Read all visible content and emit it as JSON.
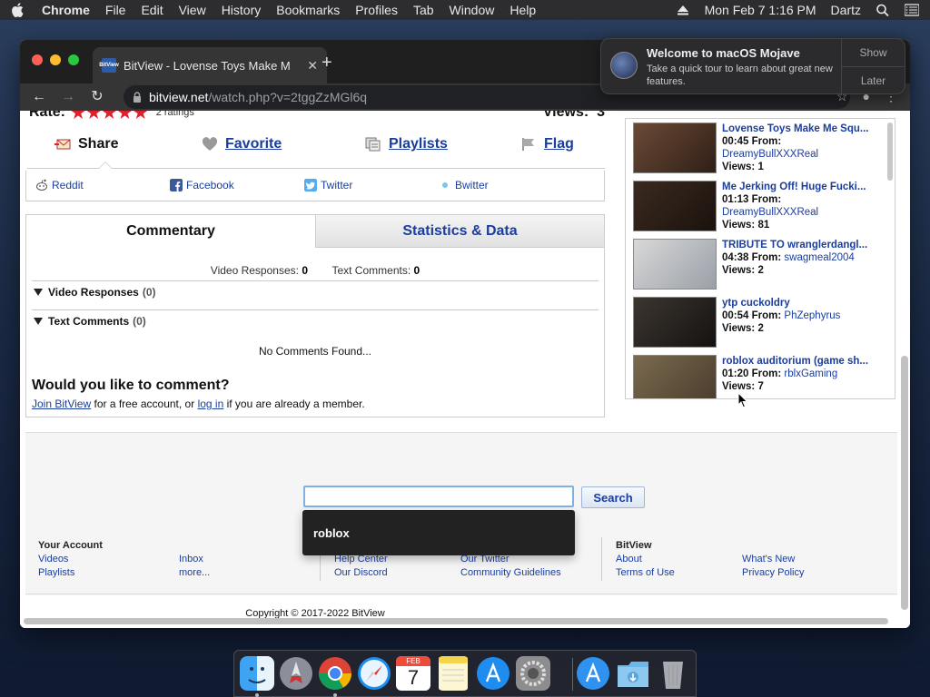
{
  "menubar": {
    "app": "Chrome",
    "items": [
      "File",
      "Edit",
      "View",
      "History",
      "Bookmarks",
      "Profiles",
      "Tab",
      "Window",
      "Help"
    ],
    "clock": "Mon Feb 7  1:16 PM",
    "user": "Dartz"
  },
  "browser": {
    "tab_title": "BitView - Lovense Toys Make M",
    "favicon_text": "BitView",
    "url_host": "bitview.net",
    "url_path": "/watch.php?v=2tggZzMGl6q"
  },
  "video": {
    "rate_label": "Rate:",
    "stars": "★★★★★",
    "ratings": "2 ratings",
    "views_label": "Views:",
    "views_value": "3"
  },
  "actions": {
    "share": "Share",
    "favorite": "Favorite",
    "playlists": "Playlists",
    "flag": "Flag"
  },
  "social": {
    "reddit": "Reddit",
    "facebook": "Facebook",
    "twitter": "Twitter",
    "bwitter": "Bwitter"
  },
  "comments_panel": {
    "tab_active": "Commentary",
    "tab_inactive": "Statistics & Data",
    "video_responses_label": "Video Responses:",
    "video_responses_value": "0",
    "text_comments_label": "Text Comments:",
    "text_comments_value": "0",
    "section_video_responses": "Video Responses",
    "section_video_responses_count": "(0)",
    "section_text_comments": "Text Comments",
    "section_text_comments_count": "(0)",
    "no_comments": "No Comments Found...",
    "comment_prompt": "Would you like to comment?",
    "join_link": "Join BitView",
    "join_text": " for a free account, or ",
    "login_link": "log in",
    "login_text": " if you are already a member."
  },
  "related": [
    {
      "title": "Lovense Toys Make Me Squ...",
      "duration": "00:45",
      "from_label": "From:",
      "user": "DreamyBullXXXReal",
      "views_label": "Views:",
      "views": "1",
      "user_newline": true
    },
    {
      "title": "Me Jerking Off! Huge Fucki...",
      "duration": "01:13",
      "from_label": "From:",
      "user": "DreamyBullXXXReal",
      "views_label": "Views:",
      "views": "81",
      "user_newline": true
    },
    {
      "title": "TRIBUTE TO wranglerdangl...",
      "duration": "04:38",
      "from_label": "From:",
      "user": "swagmeal2004",
      "views_label": "Views:",
      "views": "2",
      "user_newline": false
    },
    {
      "title": "ytp cuckoldry",
      "duration": "00:54",
      "from_label": "From:",
      "user": "PhZephyrus",
      "views_label": "Views:",
      "views": "2",
      "user_newline": false
    },
    {
      "title": "roblox auditorium (game sh...",
      "duration": "01:20",
      "from_label": "From:",
      "user": "rblxGaming",
      "views_label": "Views:",
      "views": "7",
      "user_newline": false
    }
  ],
  "search": {
    "value": "",
    "button": "Search",
    "suggestion": "roblox"
  },
  "footer": {
    "col1_title": "Your Account",
    "col1_links": [
      "Videos",
      "Playlists"
    ],
    "col2_links": [
      "Inbox",
      "more..."
    ],
    "col3_links": [
      "Help Center",
      "Our Discord"
    ],
    "col4_links": [
      "Our Twitter",
      "Community Guidelines"
    ],
    "col5_title": "BitView",
    "col5_links": [
      "About",
      "Terms of Use"
    ],
    "col6_links": [
      "What's New",
      "Privacy Policy"
    ],
    "copyright": "Copyright © 2017-2022 BitView"
  },
  "notification": {
    "title": "Welcome to macOS Mojave",
    "body": "Take a quick tour to learn about great new features.",
    "show": "Show",
    "later": "Later"
  },
  "dock": [
    "finder-icon",
    "launchpad-icon",
    "chrome-icon",
    "safari-icon",
    "calendar-icon",
    "notes-icon",
    "app-store-icon",
    "system-preferences-icon",
    "app-store-folder-icon",
    "downloads-folder-icon",
    "trash-icon"
  ],
  "calendar": {
    "month": "FEB",
    "day": "7"
  }
}
